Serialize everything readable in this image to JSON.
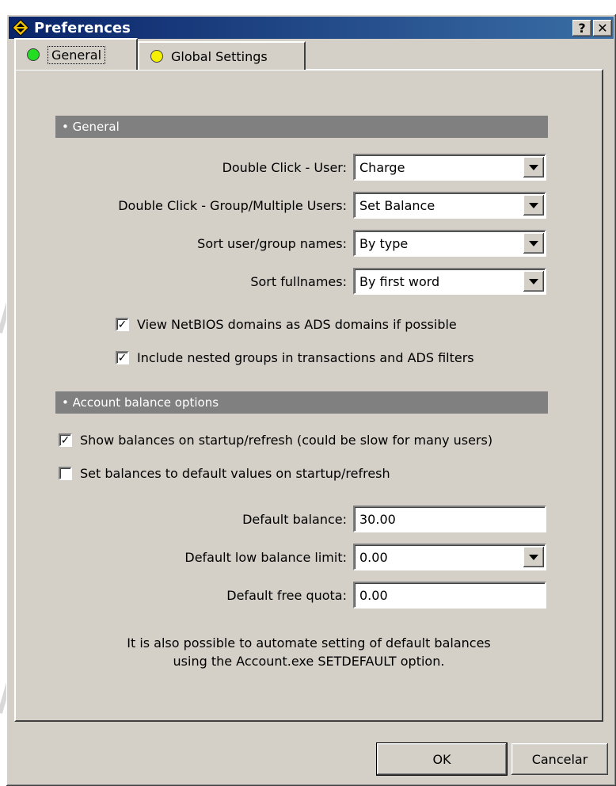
{
  "window": {
    "title": "Preferences",
    "help_button": "?",
    "close_button": "✕"
  },
  "tabs": [
    {
      "label": "General",
      "indicator_color": "#22dd22"
    },
    {
      "label": "Global Settings",
      "indicator_color": "#f5f000"
    }
  ],
  "general": {
    "header": "General",
    "fields": [
      {
        "label": "Double Click - User:",
        "value": "Charge"
      },
      {
        "label": "Double Click - Group/Multiple Users:",
        "value": "Set Balance"
      },
      {
        "label": "Sort user/group names:",
        "value": "By type"
      },
      {
        "label": "Sort fullnames:",
        "value": "By first word"
      }
    ],
    "checkboxes": [
      {
        "label": "View NetBIOS domains as ADS domains if possible",
        "checked": true
      },
      {
        "label": "Include nested groups in transactions and ADS filters",
        "checked": true
      }
    ]
  },
  "balance": {
    "header": "Account balance options",
    "checkboxes": [
      {
        "label": "Show balances on startup/refresh (could be slow for many users)",
        "checked": true
      },
      {
        "label": "Set balances to default values on startup/refresh",
        "checked": false
      }
    ],
    "default_balance": {
      "label": "Default balance:",
      "value": "30.00"
    },
    "low_limit": {
      "label": "Default low balance limit:",
      "value": "0.00"
    },
    "free_quota": {
      "label": "Default free quota:",
      "value": "0.00"
    },
    "note_line1": "It is also possible to automate setting of default balances",
    "note_line2": "using the Account.exe SETDEFAULT option."
  },
  "buttons": {
    "ok": "OK",
    "cancel": "Cancelar"
  },
  "colors": {
    "titlebar_start": "#0a246a",
    "titlebar_end": "#3a6ea5",
    "face": "#d4d0c8",
    "section_header": "#808080"
  }
}
